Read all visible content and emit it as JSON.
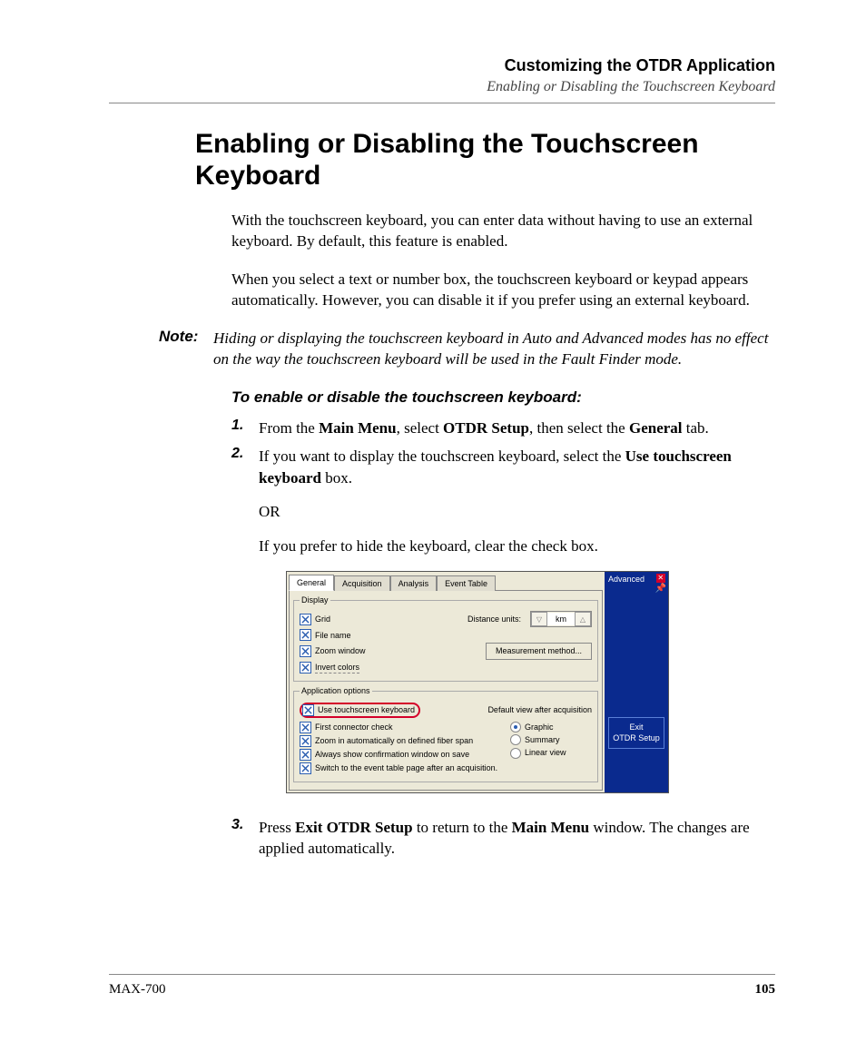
{
  "header": {
    "title": "Customizing the OTDR Application",
    "subtitle": "Enabling or Disabling the Touchscreen Keyboard"
  },
  "h1": "Enabling or Disabling the Touchscreen Keyboard",
  "p1": "With the touchscreen keyboard, you can enter data without having to use an external keyboard. By default, this feature is enabled.",
  "p2": "When you select a text or number box, the touchscreen keyboard or keypad appears automatically. However, you can disable it if you prefer using an external keyboard.",
  "note_label": "Note:",
  "note": "Hiding or displaying the touchscreen keyboard in Auto and Advanced modes has no effect on the way the touchscreen keyboard will be used in the Fault Finder mode.",
  "proc_h": "To enable or disable the touchscreen keyboard:",
  "steps": {
    "s1": {
      "n": "1.",
      "a": "From the ",
      "b1": "Main Menu",
      "c": ", select ",
      "b2": "OTDR Setup",
      "d": ", then select the ",
      "b3": "General",
      "e": " tab."
    },
    "s2": {
      "n": "2.",
      "a": "If you want to display the touchscreen keyboard, select the ",
      "b1": "Use touchscreen keyboard",
      "c": " box.",
      "or": "OR",
      "d": "If you prefer to hide the keyboard, clear the check box."
    },
    "s3": {
      "n": "3.",
      "a": "Press ",
      "b1": "Exit OTDR Setup",
      "c": " to return to the ",
      "b2": "Main Menu",
      "d": " window. The changes are applied automatically."
    }
  },
  "shot": {
    "tabs": {
      "general": "General",
      "acquisition": "Acquisition",
      "analysis": "Analysis",
      "event": "Event Table"
    },
    "display_legend": "Display",
    "grid": "Grid",
    "filename": "File name",
    "zoomw": "Zoom window",
    "invert": "Invert colors",
    "distance_units": "Distance units:",
    "du_val": "km",
    "meas_btn": "Measurement method...",
    "app_legend": "Application options",
    "use_tk": "Use touchscreen keyboard",
    "first_conn": "First connector check",
    "zoom_auto": "Zoom in automatically on defined fiber span",
    "always_conf": "Always show confirmation window on save",
    "switch_evt": "Switch to the event table page after an acquisition.",
    "default_view": "Default view after acquisition",
    "graphic": "Graphic",
    "summary": "Summary",
    "linear": "Linear view",
    "side_mode": "Advanced",
    "exit_l1": "Exit",
    "exit_l2": "OTDR Setup"
  },
  "footer": {
    "model": "MAX-700",
    "page": "105"
  }
}
